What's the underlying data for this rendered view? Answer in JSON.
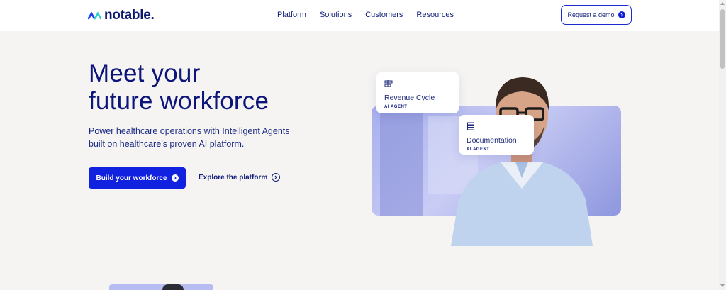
{
  "brand": {
    "name": "notable."
  },
  "nav": {
    "links": [
      "Platform",
      "Solutions",
      "Customers",
      "Resources"
    ],
    "cta_label": "Request a demo"
  },
  "hero": {
    "headline_line1": "Meet your",
    "headline_line2": "future workforce",
    "subtext": "Power healthcare operations with Intelligent Agents built on healthcare’s proven AI platform.",
    "primary_label": "Build your workforce",
    "secondary_label": "Explore the platform"
  },
  "agent_cards": [
    {
      "title": "Revenue Cycle",
      "tag": "AI AGENT",
      "icon": "workflow-icon"
    },
    {
      "title": "Documentation",
      "tag": "AI AGENT",
      "icon": "document-stack-icon"
    }
  ],
  "colors": {
    "brand_blue": "#1121e0",
    "navy_text": "#0b157a",
    "hero_bg": "#f6f4f2"
  }
}
